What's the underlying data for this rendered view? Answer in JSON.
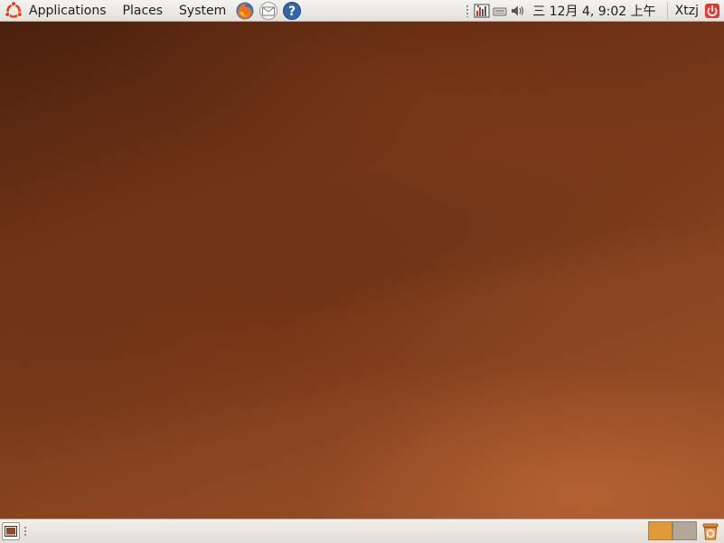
{
  "top_panel": {
    "menus": [
      {
        "label": "Applications",
        "icon": "ubuntu-logo-icon"
      },
      {
        "label": "Places"
      },
      {
        "label": "System"
      }
    ],
    "launchers": [
      {
        "name": "firefox-launcher",
        "icon": "firefox-icon"
      },
      {
        "name": "mail-launcher",
        "icon": "envelope-icon"
      },
      {
        "name": "help-launcher",
        "icon": "help-icon"
      }
    ],
    "tray": {
      "clock": "三  12月  4,  9:02 上午",
      "user": "Xtzj"
    }
  },
  "bottom_panel": {
    "workspaces": [
      {
        "active": true,
        "color": "#e19a37"
      },
      {
        "active": false,
        "color": "#b3a79a"
      }
    ]
  },
  "colors": {
    "panel": "#ede9e3",
    "wallpaper": "#7a3a1a",
    "accent": "#e19a37"
  }
}
